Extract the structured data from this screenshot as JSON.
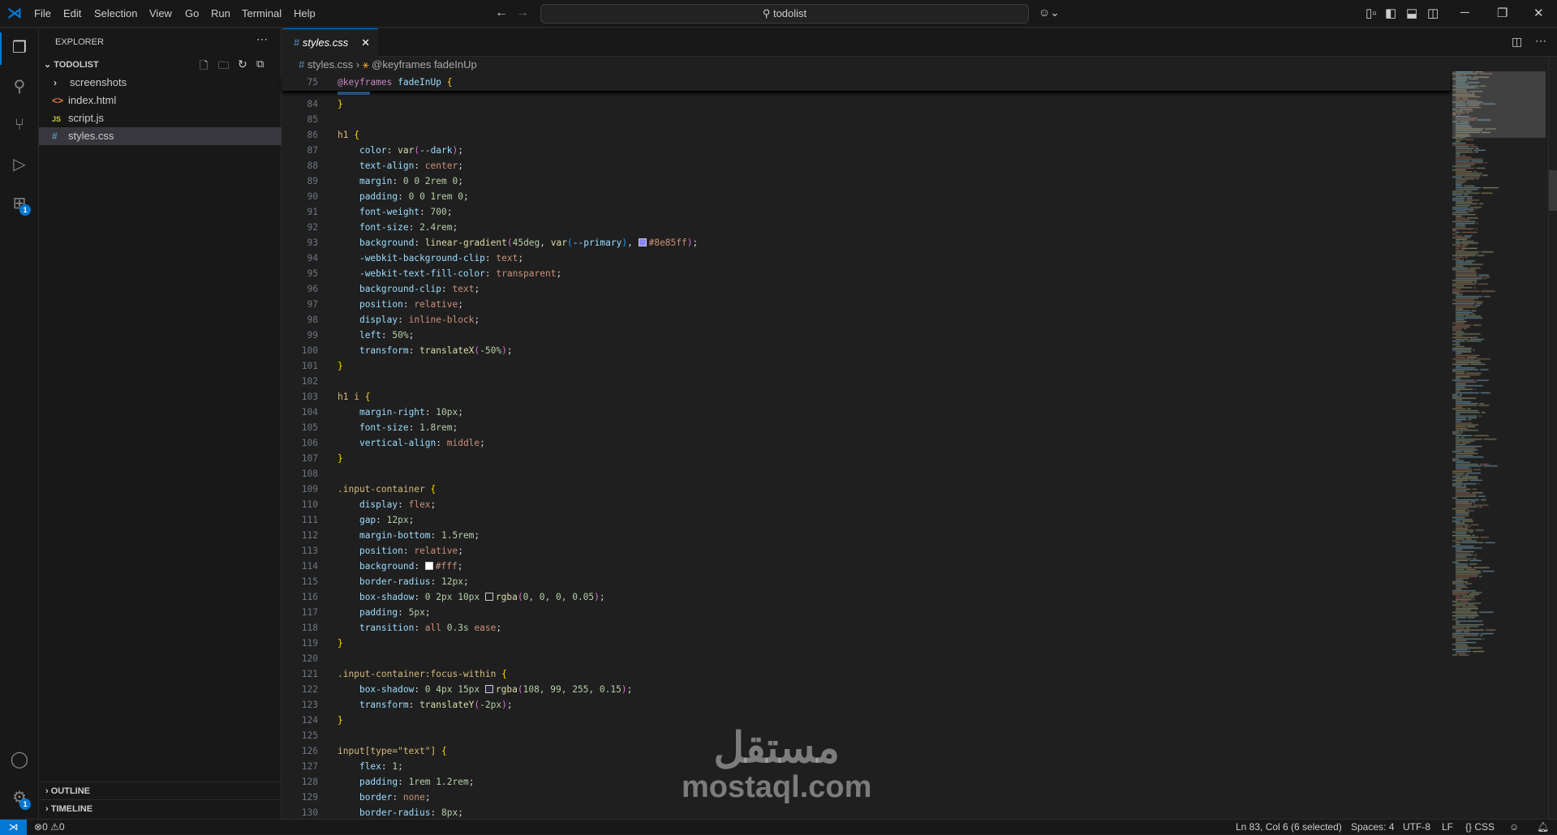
{
  "menu": [
    "File",
    "Edit",
    "Selection",
    "View",
    "Go",
    "Run",
    "Terminal",
    "Help"
  ],
  "search": {
    "text": "todolist"
  },
  "sidebar": {
    "title": "EXPLORER",
    "folder": "TODOLIST",
    "items": [
      {
        "name": "screenshots",
        "icon": "chevron-right",
        "color": "#cccccc"
      },
      {
        "name": "index.html",
        "icon": "<>",
        "color": "#e37933"
      },
      {
        "name": "script.js",
        "icon": "JS",
        "color": "#cbcb41"
      },
      {
        "name": "styles.css",
        "icon": "#",
        "color": "#519aba"
      }
    ],
    "outline": "OUTLINE",
    "timeline": "TIMELINE",
    "extensions_badge": "1",
    "settings_badge": "1"
  },
  "tab": {
    "label": "styles.css",
    "icon": "#"
  },
  "breadcrumb": {
    "file": "styles.css",
    "symbol": "@keyframes fadeInUp"
  },
  "sticky": {
    "num": "75",
    "tokens": [
      [
        "at",
        "@keyframes "
      ],
      [
        "id",
        "fadeInUp "
      ],
      [
        "b",
        "{"
      ]
    ]
  },
  "code": [
    {
      "num": "84",
      "t": [
        [
          "b",
          "}"
        ]
      ]
    },
    {
      "num": "85",
      "t": []
    },
    {
      "num": "86",
      "t": [
        [
          "s",
          "h1 "
        ],
        [
          "b",
          "{"
        ]
      ]
    },
    {
      "num": "87",
      "t": [
        [
          "d",
          "    "
        ],
        [
          "p",
          "color"
        ],
        [
          "d",
          ": "
        ],
        [
          "f",
          "var"
        ],
        [
          "pa",
          "("
        ],
        [
          "p",
          "--dark"
        ],
        [
          "pa",
          ")"
        ],
        [
          "d",
          ";"
        ]
      ]
    },
    {
      "num": "88",
      "t": [
        [
          "d",
          "    "
        ],
        [
          "p",
          "text-align"
        ],
        [
          "d",
          ": "
        ],
        [
          "k",
          "center"
        ],
        [
          "d",
          ";"
        ]
      ]
    },
    {
      "num": "89",
      "t": [
        [
          "d",
          "    "
        ],
        [
          "p",
          "margin"
        ],
        [
          "d",
          ": "
        ],
        [
          "n",
          "0 0 2rem 0"
        ],
        [
          "d",
          ";"
        ]
      ]
    },
    {
      "num": "90",
      "t": [
        [
          "d",
          "    "
        ],
        [
          "p",
          "padding"
        ],
        [
          "d",
          ": "
        ],
        [
          "n",
          "0 0 1rem 0"
        ],
        [
          "d",
          ";"
        ]
      ]
    },
    {
      "num": "91",
      "t": [
        [
          "d",
          "    "
        ],
        [
          "p",
          "font-weight"
        ],
        [
          "d",
          ": "
        ],
        [
          "n",
          "700"
        ],
        [
          "d",
          ";"
        ]
      ]
    },
    {
      "num": "92",
      "t": [
        [
          "d",
          "    "
        ],
        [
          "p",
          "font-size"
        ],
        [
          "d",
          ": "
        ],
        [
          "n",
          "2.4rem"
        ],
        [
          "d",
          ";"
        ]
      ]
    },
    {
      "num": "93",
      "t": [
        [
          "d",
          "    "
        ],
        [
          "p",
          "background"
        ],
        [
          "d",
          ": "
        ],
        [
          "f",
          "linear-gradient"
        ],
        [
          "pa",
          "("
        ],
        [
          "n",
          "45deg"
        ],
        [
          "d",
          ", "
        ],
        [
          "f",
          "var"
        ],
        [
          "pb",
          "("
        ],
        [
          "p",
          "--primary"
        ],
        [
          "pb",
          ")"
        ],
        [
          "d",
          ", "
        ],
        [
          "sw",
          "#8e85ff"
        ],
        [
          "k",
          "#8e85ff"
        ],
        [
          "pa",
          ")"
        ],
        [
          "d",
          ";"
        ]
      ]
    },
    {
      "num": "94",
      "t": [
        [
          "d",
          "    "
        ],
        [
          "p",
          "-webkit-background-clip"
        ],
        [
          "d",
          ": "
        ],
        [
          "k",
          "text"
        ],
        [
          "d",
          ";"
        ]
      ]
    },
    {
      "num": "95",
      "t": [
        [
          "d",
          "    "
        ],
        [
          "p",
          "-webkit-text-fill-color"
        ],
        [
          "d",
          ": "
        ],
        [
          "k",
          "transparent"
        ],
        [
          "d",
          ";"
        ]
      ]
    },
    {
      "num": "96",
      "t": [
        [
          "d",
          "    "
        ],
        [
          "p",
          "background-clip"
        ],
        [
          "d",
          ": "
        ],
        [
          "k",
          "text"
        ],
        [
          "d",
          ";"
        ]
      ]
    },
    {
      "num": "97",
      "t": [
        [
          "d",
          "    "
        ],
        [
          "p",
          "position"
        ],
        [
          "d",
          ": "
        ],
        [
          "k",
          "relative"
        ],
        [
          "d",
          ";"
        ]
      ]
    },
    {
      "num": "98",
      "t": [
        [
          "d",
          "    "
        ],
        [
          "p",
          "display"
        ],
        [
          "d",
          ": "
        ],
        [
          "k",
          "inline-block"
        ],
        [
          "d",
          ";"
        ]
      ]
    },
    {
      "num": "99",
      "t": [
        [
          "d",
          "    "
        ],
        [
          "p",
          "left"
        ],
        [
          "d",
          ": "
        ],
        [
          "n",
          "50%"
        ],
        [
          "d",
          ";"
        ]
      ]
    },
    {
      "num": "100",
      "t": [
        [
          "d",
          "    "
        ],
        [
          "p",
          "transform"
        ],
        [
          "d",
          ": "
        ],
        [
          "f",
          "translateX"
        ],
        [
          "pa",
          "("
        ],
        [
          "n",
          "-50%"
        ],
        [
          "pa",
          ")"
        ],
        [
          "d",
          ";"
        ]
      ]
    },
    {
      "num": "101",
      "t": [
        [
          "b",
          "}"
        ]
      ]
    },
    {
      "num": "102",
      "t": []
    },
    {
      "num": "103",
      "t": [
        [
          "s",
          "h1 i "
        ],
        [
          "b",
          "{"
        ]
      ]
    },
    {
      "num": "104",
      "t": [
        [
          "d",
          "    "
        ],
        [
          "p",
          "margin-right"
        ],
        [
          "d",
          ": "
        ],
        [
          "n",
          "10px"
        ],
        [
          "d",
          ";"
        ]
      ]
    },
    {
      "num": "105",
      "t": [
        [
          "d",
          "    "
        ],
        [
          "p",
          "font-size"
        ],
        [
          "d",
          ": "
        ],
        [
          "n",
          "1.8rem"
        ],
        [
          "d",
          ";"
        ]
      ]
    },
    {
      "num": "106",
      "t": [
        [
          "d",
          "    "
        ],
        [
          "p",
          "vertical-align"
        ],
        [
          "d",
          ": "
        ],
        [
          "k",
          "middle"
        ],
        [
          "d",
          ";"
        ]
      ]
    },
    {
      "num": "107",
      "t": [
        [
          "b",
          "}"
        ]
      ]
    },
    {
      "num": "108",
      "t": []
    },
    {
      "num": "109",
      "t": [
        [
          "s",
          ".input-container "
        ],
        [
          "b",
          "{"
        ]
      ]
    },
    {
      "num": "110",
      "t": [
        [
          "d",
          "    "
        ],
        [
          "p",
          "display"
        ],
        [
          "d",
          ": "
        ],
        [
          "k",
          "flex"
        ],
        [
          "d",
          ";"
        ]
      ]
    },
    {
      "num": "111",
      "t": [
        [
          "d",
          "    "
        ],
        [
          "p",
          "gap"
        ],
        [
          "d",
          ": "
        ],
        [
          "n",
          "12px"
        ],
        [
          "d",
          ";"
        ]
      ]
    },
    {
      "num": "112",
      "t": [
        [
          "d",
          "    "
        ],
        [
          "p",
          "margin-bottom"
        ],
        [
          "d",
          ": "
        ],
        [
          "n",
          "1.5rem"
        ],
        [
          "d",
          ";"
        ]
      ]
    },
    {
      "num": "113",
      "t": [
        [
          "d",
          "    "
        ],
        [
          "p",
          "position"
        ],
        [
          "d",
          ": "
        ],
        [
          "k",
          "relative"
        ],
        [
          "d",
          ";"
        ]
      ]
    },
    {
      "num": "114",
      "t": [
        [
          "d",
          "    "
        ],
        [
          "p",
          "background"
        ],
        [
          "d",
          ": "
        ],
        [
          "sw",
          "#ffffff"
        ],
        [
          "k",
          "#fff"
        ],
        [
          "d",
          ";"
        ]
      ]
    },
    {
      "num": "115",
      "t": [
        [
          "d",
          "    "
        ],
        [
          "p",
          "border-radius"
        ],
        [
          "d",
          ": "
        ],
        [
          "n",
          "12px"
        ],
        [
          "d",
          ";"
        ]
      ]
    },
    {
      "num": "116",
      "t": [
        [
          "d",
          "    "
        ],
        [
          "p",
          "box-shadow"
        ],
        [
          "d",
          ": "
        ],
        [
          "n",
          "0 2px 10px "
        ],
        [
          "sw",
          "rgba(0,0,0,0.05)"
        ],
        [
          "f",
          "rgba"
        ],
        [
          "pa",
          "("
        ],
        [
          "n",
          "0, 0, 0, 0.05"
        ],
        [
          "pa",
          ")"
        ],
        [
          "d",
          ";"
        ]
      ]
    },
    {
      "num": "117",
      "t": [
        [
          "d",
          "    "
        ],
        [
          "p",
          "padding"
        ],
        [
          "d",
          ": "
        ],
        [
          "n",
          "5px"
        ],
        [
          "d",
          ";"
        ]
      ]
    },
    {
      "num": "118",
      "t": [
        [
          "d",
          "    "
        ],
        [
          "p",
          "transition"
        ],
        [
          "d",
          ": "
        ],
        [
          "k",
          "all "
        ],
        [
          "n",
          "0.3s "
        ],
        [
          "k",
          "ease"
        ],
        [
          "d",
          ";"
        ]
      ]
    },
    {
      "num": "119",
      "t": [
        [
          "b",
          "}"
        ]
      ]
    },
    {
      "num": "120",
      "t": []
    },
    {
      "num": "121",
      "t": [
        [
          "s",
          ".input-container:focus-within "
        ],
        [
          "b",
          "{"
        ]
      ]
    },
    {
      "num": "122",
      "t": [
        [
          "d",
          "    "
        ],
        [
          "p",
          "box-shadow"
        ],
        [
          "d",
          ": "
        ],
        [
          "n",
          "0 4px 15px "
        ],
        [
          "sw",
          "rgba(108,99,255,0.15)"
        ],
        [
          "f",
          "rgba"
        ],
        [
          "pa",
          "("
        ],
        [
          "n",
          "108, 99, 255, 0.15"
        ],
        [
          "pa",
          ")"
        ],
        [
          "d",
          ";"
        ]
      ]
    },
    {
      "num": "123",
      "t": [
        [
          "d",
          "    "
        ],
        [
          "p",
          "transform"
        ],
        [
          "d",
          ": "
        ],
        [
          "f",
          "translateY"
        ],
        [
          "pa",
          "("
        ],
        [
          "n",
          "-2px"
        ],
        [
          "pa",
          ")"
        ],
        [
          "d",
          ";"
        ]
      ]
    },
    {
      "num": "124",
      "t": [
        [
          "b",
          "}"
        ]
      ]
    },
    {
      "num": "125",
      "t": []
    },
    {
      "num": "126",
      "t": [
        [
          "s",
          "input[type=\"text\"] "
        ],
        [
          "b",
          "{"
        ]
      ]
    },
    {
      "num": "127",
      "t": [
        [
          "d",
          "    "
        ],
        [
          "p",
          "flex"
        ],
        [
          "d",
          ": "
        ],
        [
          "n",
          "1"
        ],
        [
          "d",
          ";"
        ]
      ]
    },
    {
      "num": "128",
      "t": [
        [
          "d",
          "    "
        ],
        [
          "p",
          "padding"
        ],
        [
          "d",
          ": "
        ],
        [
          "n",
          "1rem 1.2rem"
        ],
        [
          "d",
          ";"
        ]
      ]
    },
    {
      "num": "129",
      "t": [
        [
          "d",
          "    "
        ],
        [
          "p",
          "border"
        ],
        [
          "d",
          ": "
        ],
        [
          "k",
          "none"
        ],
        [
          "d",
          ";"
        ]
      ]
    },
    {
      "num": "130",
      "t": [
        [
          "d",
          "    "
        ],
        [
          "p",
          "border-radius"
        ],
        [
          "d",
          ": "
        ],
        [
          "n",
          "8px"
        ],
        [
          "d",
          ";"
        ]
      ]
    }
  ],
  "status": {
    "errors": "0",
    "warnings": "0",
    "position": "Ln 83, Col 6 (6 selected)",
    "spaces": "Spaces: 4",
    "encoding": "UTF-8",
    "eol": "LF",
    "language": "CSS"
  },
  "watermark": {
    "arabic": "مستقل",
    "latin": "mostaql.com"
  }
}
